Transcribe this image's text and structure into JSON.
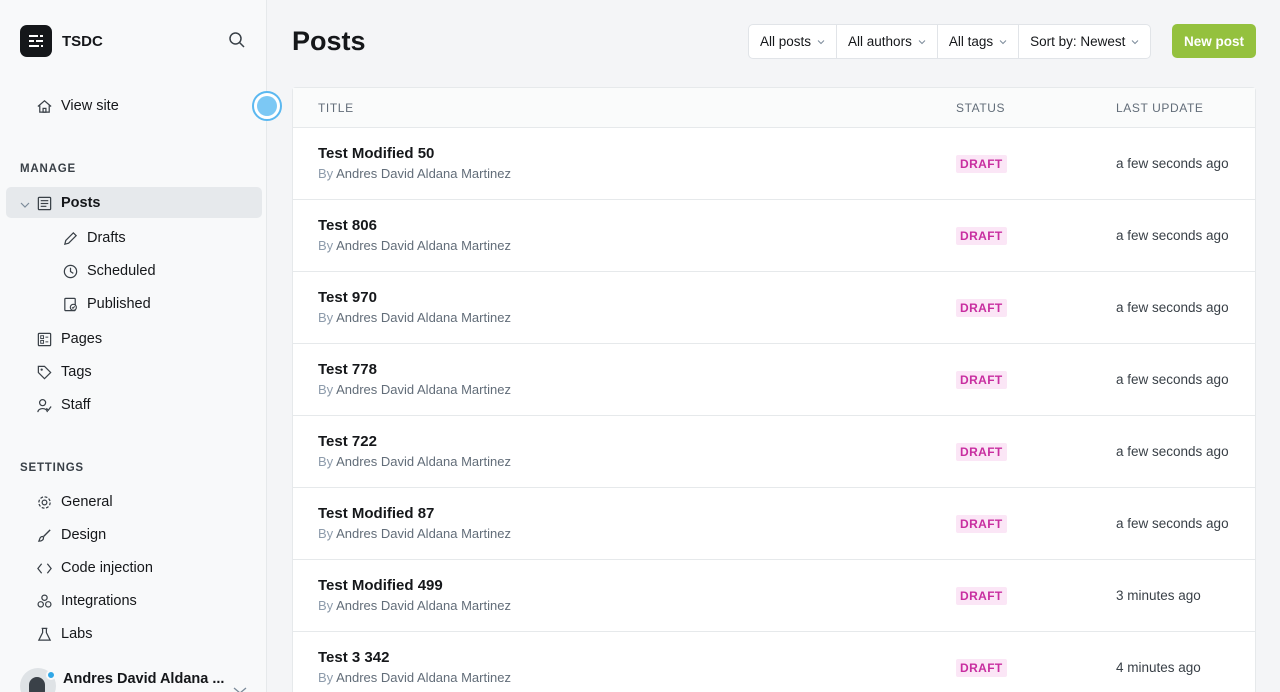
{
  "sidebar": {
    "brand": "TSDC",
    "view_site": "View site",
    "manage_title": "MANAGE",
    "posts": "Posts",
    "sub_items": [
      "Drafts",
      "Scheduled",
      "Published"
    ],
    "manage_items": [
      "Pages",
      "Tags",
      "Staff"
    ],
    "settings_title": "SETTINGS",
    "settings_items": [
      "General",
      "Design",
      "Code injection",
      "Integrations",
      "Labs"
    ],
    "user_name": "Andres David Aldana ..."
  },
  "header": {
    "title": "Posts",
    "filters": [
      "All posts",
      "All authors",
      "All tags",
      "Sort by: Newest"
    ],
    "new_post": "New post"
  },
  "table": {
    "columns": [
      "TITLE",
      "STATUS",
      "LAST UPDATE"
    ],
    "by_prefix": "By",
    "rows": [
      {
        "title": "Test Modified 50",
        "author": "Andres David Aldana Martinez",
        "status": "DRAFT",
        "updated": "a few seconds ago"
      },
      {
        "title": "Test 806",
        "author": "Andres David Aldana Martinez",
        "status": "DRAFT",
        "updated": "a few seconds ago"
      },
      {
        "title": "Test 970",
        "author": "Andres David Aldana Martinez",
        "status": "DRAFT",
        "updated": "a few seconds ago"
      },
      {
        "title": "Test 778",
        "author": "Andres David Aldana Martinez",
        "status": "DRAFT",
        "updated": "a few seconds ago"
      },
      {
        "title": "Test 722",
        "author": "Andres David Aldana Martinez",
        "status": "DRAFT",
        "updated": "a few seconds ago"
      },
      {
        "title": "Test Modified 87",
        "author": "Andres David Aldana Martinez",
        "status": "DRAFT",
        "updated": "a few seconds ago"
      },
      {
        "title": "Test Modified 499",
        "author": "Andres David Aldana Martinez",
        "status": "DRAFT",
        "updated": "3 minutes ago"
      },
      {
        "title": "Test 3 342",
        "author": "Andres David Aldana Martinez",
        "status": "DRAFT",
        "updated": "4 minutes ago"
      }
    ]
  },
  "colors": {
    "accent_green": "#94c13e",
    "draft_badge_bg": "#fbe6f6",
    "draft_badge_text": "#c82ea0",
    "focus_ring": "#5bb8f0"
  }
}
